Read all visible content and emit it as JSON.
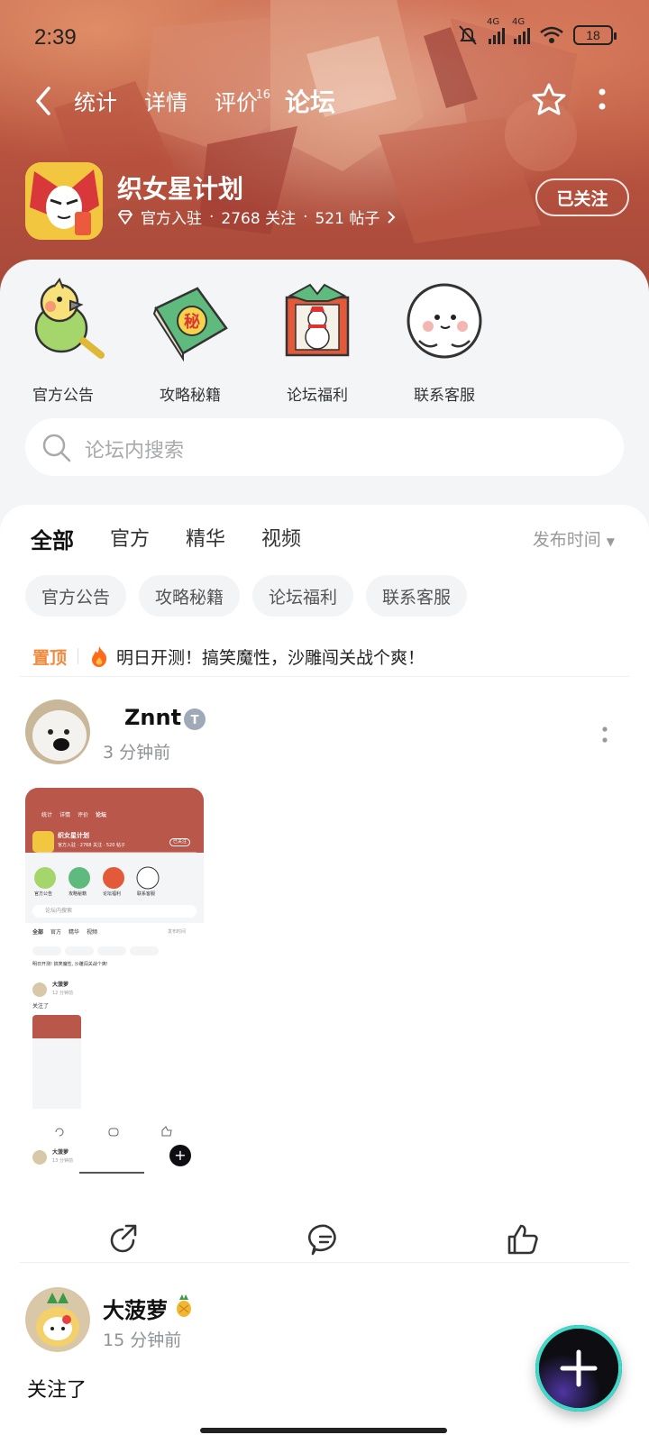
{
  "status_bar": {
    "time": "2:39",
    "battery": "18",
    "net1": "4G",
    "net2": "4G"
  },
  "nav": {
    "tabs": [
      {
        "label": "统计"
      },
      {
        "label": "详情"
      },
      {
        "label": "评价",
        "badge": "16"
      },
      {
        "label": "论坛"
      }
    ]
  },
  "app": {
    "name": "织女星计划",
    "official_label": "官方入驻",
    "followers": "2768 关注",
    "posts": "521 帖子",
    "follow_button": "已关注"
  },
  "quick_entries": [
    {
      "label": "官方公告",
      "icon": "parrot-icon"
    },
    {
      "label": "攻略秘籍",
      "icon": "secret-book-icon"
    },
    {
      "label": "论坛福利",
      "icon": "gift-snowman-icon"
    },
    {
      "label": "联系客服",
      "icon": "support-face-icon"
    }
  ],
  "search": {
    "placeholder": "论坛内搜索"
  },
  "filter_tabs": [
    {
      "label": "全部"
    },
    {
      "label": "官方"
    },
    {
      "label": "精华"
    },
    {
      "label": "视频"
    }
  ],
  "sort_label": "发布时间",
  "chips": [
    {
      "label": "官方公告"
    },
    {
      "label": "攻略秘籍"
    },
    {
      "label": "论坛福利"
    },
    {
      "label": "联系客服"
    }
  ],
  "pinned": {
    "tag": "置顶",
    "text": "明日开测！搞笑魔性，沙雕闯关战个爽！"
  },
  "posts": [
    {
      "user": "Znnt",
      "time": "3 分钟前"
    },
    {
      "user": "大菠萝",
      "time": "15 分钟前",
      "text": "关注了"
    }
  ],
  "thumbnail": {
    "tabs": [
      "统计",
      "详情",
      "评价",
      "论坛"
    ],
    "app_name": "织女星计划",
    "meta": "官方入驻 · 2768 关注 · 520 帖子",
    "follow": "已关注",
    "quick": [
      "官方公告",
      "攻略秘籍",
      "论坛福利",
      "联系客服"
    ],
    "search": "论坛内搜索",
    "filter": [
      "全部",
      "官方",
      "精华",
      "视频"
    ],
    "sort": "发布时间",
    "pinned": "明日开测! 搞笑魔性, 沙雕闯关战个爽!",
    "user": "大菠萝",
    "time": "12 分钟前",
    "text": "关注了",
    "user2": "大菠萝",
    "time2": "13 分钟前"
  }
}
